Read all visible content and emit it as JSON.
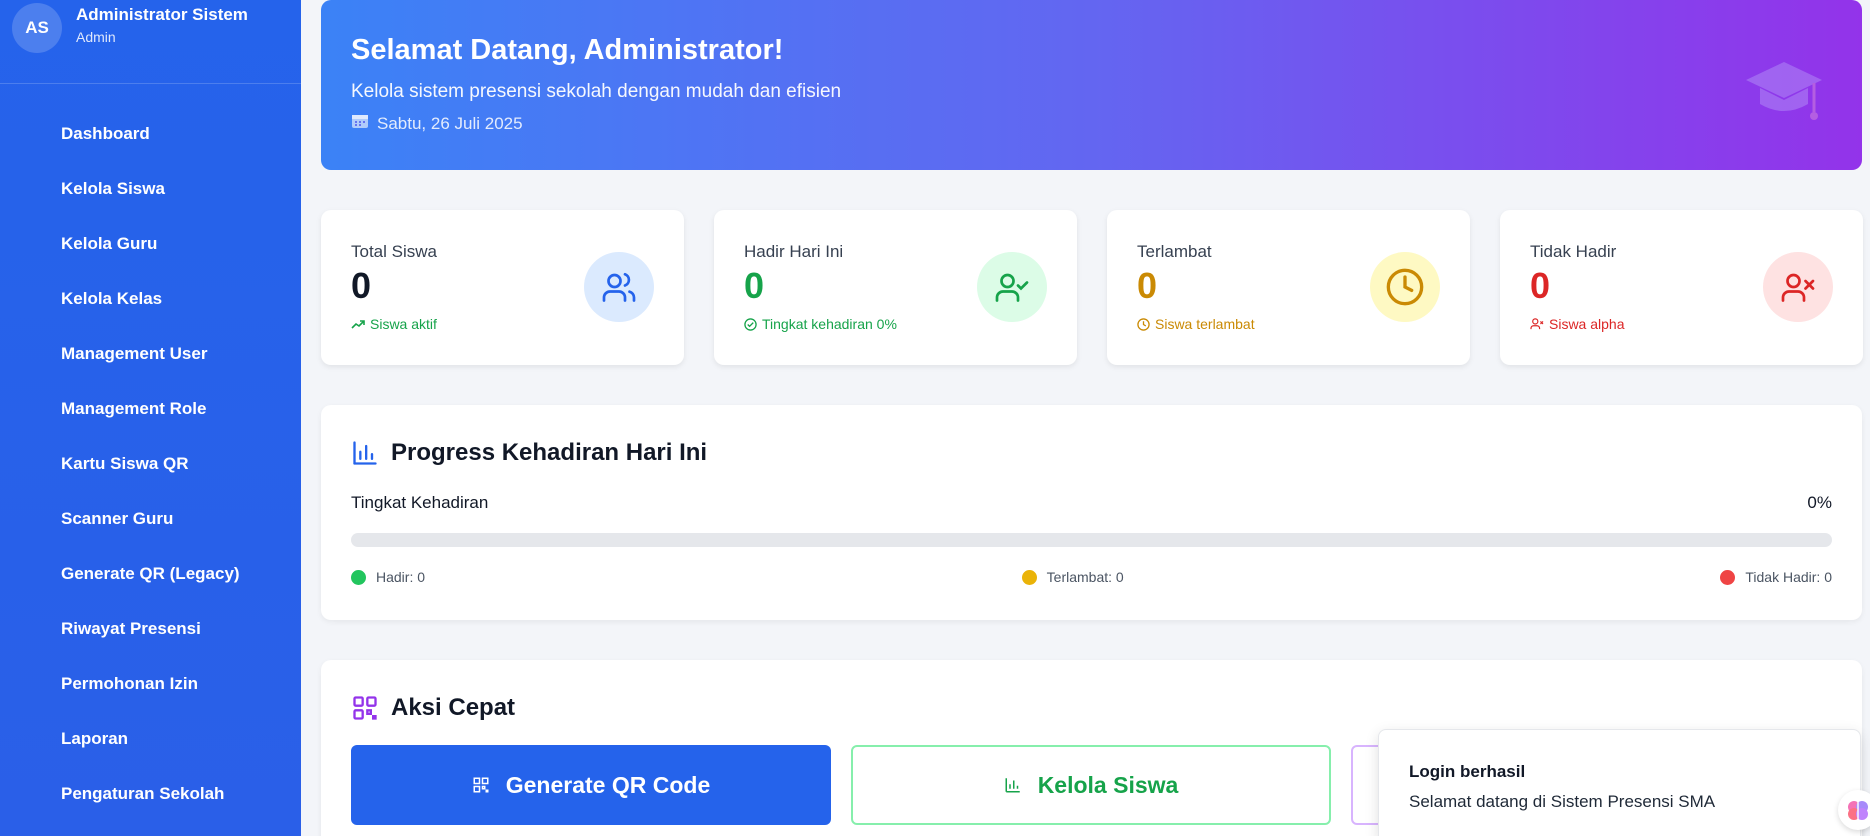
{
  "user": {
    "initials": "AS",
    "name": "Administrator Sistem",
    "role": "Admin"
  },
  "nav": [
    "Dashboard",
    "Kelola Siswa",
    "Kelola Guru",
    "Kelola Kelas",
    "Management User",
    "Management Role",
    "Kartu Siswa QR",
    "Scanner Guru",
    "Generate QR (Legacy)",
    "Riwayat Presensi",
    "Permohonan Izin",
    "Laporan",
    "Pengaturan Sekolah"
  ],
  "hero": {
    "title": "Selamat Datang, Administrator!",
    "subtitle": "Kelola sistem presensi sekolah dengan mudah dan efisien",
    "date": "Sabtu, 26 Juli 2025"
  },
  "stats": [
    {
      "label": "Total Siswa",
      "value": "0",
      "note": "Siswa aktif",
      "color": "#111827",
      "note_color": "#16a34a",
      "icon": "users-icon",
      "icon_bg": "#dbeafe",
      "icon_color": "#2563eb"
    },
    {
      "label": "Hadir Hari Ini",
      "value": "0",
      "note": "Tingkat kehadiran 0%",
      "color": "#16a34a",
      "note_color": "#16a34a",
      "icon": "user-check-icon",
      "icon_bg": "#dcfce7",
      "icon_color": "#16a34a"
    },
    {
      "label": "Terlambat",
      "value": "0",
      "note": "Siswa terlambat",
      "color": "#ca8a04",
      "note_color": "#ca8a04",
      "icon": "clock-icon",
      "icon_bg": "#fef9c3",
      "icon_color": "#ca8a04"
    },
    {
      "label": "Tidak Hadir",
      "value": "0",
      "note": "Siswa alpha",
      "color": "#dc2626",
      "note_color": "#dc2626",
      "icon": "user-x-icon",
      "icon_bg": "#fee2e2",
      "icon_color": "#dc2626"
    }
  ],
  "progress": {
    "title": "Progress Kehadiran Hari Ini",
    "label": "Tingkat Kehadiran",
    "percent_text": "0%",
    "fraction": 0,
    "legend": [
      "Hadir: 0",
      "Terlambat: 0",
      "Tidak Hadir: 0"
    ],
    "legend_colors": [
      "#22c55e",
      "#eab308",
      "#ef4444"
    ]
  },
  "quick": {
    "title": "Aksi Cepat",
    "generate": "Generate QR Code",
    "kelola": "Kelola Siswa"
  },
  "toast": {
    "title": "Login berhasil",
    "message": "Selamat datang di Sistem Presensi SMA"
  }
}
